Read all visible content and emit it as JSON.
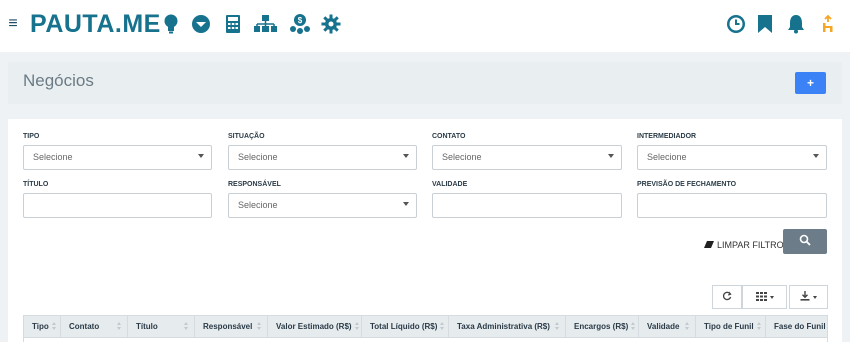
{
  "app": {
    "logo": "PAUTA.ME",
    "menu_glyph": "≡"
  },
  "colors": {
    "brand": "#16728d",
    "accent": "#3b82f6",
    "orange": "#f5a623"
  },
  "nav_icons": [
    "lightbulb-icon",
    "chat-icon",
    "calculator-icon",
    "sitemap-icon",
    "money-users-icon",
    "gear-icon"
  ],
  "right_icons": [
    "clock-icon",
    "bookmark-icon",
    "bell-icon",
    "person-up-icon"
  ],
  "page": {
    "title": "Negócios",
    "add_label": "+"
  },
  "filters": {
    "tipo": {
      "label": "TIPO",
      "value": "Selecione"
    },
    "situacao": {
      "label": "SITUAÇÃO",
      "value": "Selecione"
    },
    "contato": {
      "label": "CONTATO",
      "value": "Selecione"
    },
    "intermediador": {
      "label": "INTERMEDIADOR",
      "value": "Selecione"
    },
    "titulo": {
      "label": "TÍTULO",
      "value": ""
    },
    "responsavel": {
      "label": "RESPONSÁVEL",
      "value": "Selecione"
    },
    "validade": {
      "label": "VALIDADE",
      "value": ""
    },
    "previsao": {
      "label": "PREVISÃO DE FECHAMENTO",
      "value": ""
    }
  },
  "actions": {
    "clear_filters": "LIMPAR FILTROS"
  },
  "table": {
    "columns": [
      "Tipo",
      "Contato",
      "Título",
      "Responsável",
      "Valor Estimado (R$)",
      "Total Líquido (R$)",
      "Taxa Administrativa (R$)",
      "Encargos (R$)",
      "Validade",
      "Tipo de Funil",
      "Fase do Funil"
    ]
  }
}
